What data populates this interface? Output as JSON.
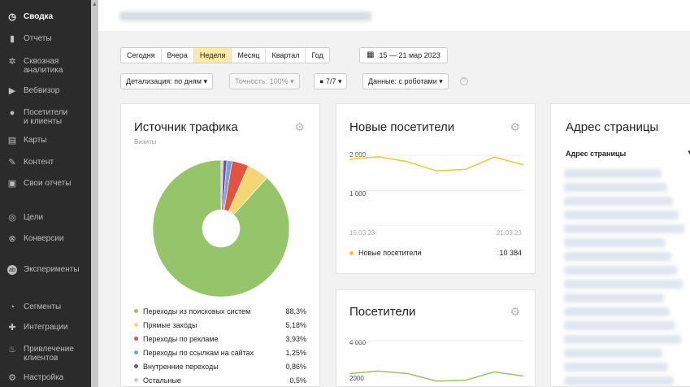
{
  "sidebar": {
    "items": [
      {
        "label": "Сводка",
        "icon": "dashboard-icon",
        "glyph": "◷",
        "active": true
      },
      {
        "label": "Отчеты",
        "icon": "bar-chart-icon",
        "glyph": "▮"
      },
      {
        "label": "Сквозная\nаналитика",
        "icon": "flower-icon",
        "glyph": "✲"
      },
      {
        "label": "Вебвизор",
        "icon": "play-icon",
        "glyph": "▶"
      },
      {
        "label": "Посетители\nи клиенты",
        "icon": "user-icon",
        "glyph": "●"
      },
      {
        "label": "Карты",
        "icon": "map-icon",
        "glyph": "▤"
      },
      {
        "label": "Контент",
        "icon": "pen-icon",
        "glyph": "✎"
      },
      {
        "label": "Свои отчеты",
        "icon": "window-icon",
        "glyph": "▣"
      },
      {
        "label": "Цели",
        "icon": "target-icon",
        "glyph": "◎"
      },
      {
        "label": "Конверсии",
        "icon": "conversion-icon",
        "glyph": "⊗"
      },
      {
        "label": "Эксперименты",
        "icon": "ab-icon",
        "glyph": "ab"
      },
      {
        "label": "Сегменты",
        "icon": "pie-icon",
        "glyph": "◔"
      },
      {
        "label": "Интеграции",
        "icon": "puzzle-icon",
        "glyph": "✚"
      },
      {
        "label": "Привлечение\nклиентов",
        "icon": "fire-icon",
        "glyph": "♨"
      },
      {
        "label": "Настройка",
        "icon": "settings-icon",
        "glyph": "⚙"
      }
    ]
  },
  "period": {
    "options": [
      "Сегодня",
      "Вчера",
      "Неделя",
      "Месяц",
      "Квартал",
      "Год"
    ],
    "selected": "Неделя"
  },
  "daterange": {
    "label": "15 — 21 мар 2023",
    "icon": "calendar-icon"
  },
  "controls": {
    "detail": "Детализация: по дням ▾",
    "accuracy": "Точность: 100% ▾",
    "segments": "● 7/7 ▾",
    "robots": "Данные: с роботами ▾"
  },
  "traffic": {
    "title": "Источник трафика",
    "subtitle": "Визиты",
    "legend": [
      {
        "label": "Переходы из поисковых систем",
        "value": "88,3%",
        "color": "#96c46b"
      },
      {
        "label": "Прямые заходы",
        "value": "5,18%",
        "color": "#f4d774"
      },
      {
        "label": "Переходы по рекламе",
        "value": "3,93%",
        "color": "#e2543f"
      },
      {
        "label": "Переходы по ссылкам на сайтах",
        "value": "1,25%",
        "color": "#6fa7d8"
      },
      {
        "label": "Внутренние переходы",
        "value": "0,86%",
        "color": "#7d4ba5"
      },
      {
        "label": "Остальные",
        "value": "0,5%",
        "color": "#cccccc"
      }
    ]
  },
  "new_visitors": {
    "title": "Новые посетители",
    "y_ticks": [
      "2 000",
      "1 000"
    ],
    "date_start": "15.03.23",
    "date_end": "21.03.23",
    "series_label": "Новые посетители",
    "series_total": "10 384",
    "series_color": "#e6c938"
  },
  "visitors": {
    "title": "Посетители",
    "y_ticks": [
      "4 000",
      "2000"
    ],
    "series_color": "#96c46b"
  },
  "page_address": {
    "title": "Адрес страницы",
    "column_header": "Адрес страницы",
    "sort_icon": "▾"
  },
  "chart_data": [
    {
      "type": "pie",
      "title": "Источник трафика",
      "subtitle": "Визиты",
      "categories": [
        "Переходы из поисковых систем",
        "Прямые заходы",
        "Переходы по рекламе",
        "Переходы по ссылкам на сайтах",
        "Внутренние переходы",
        "Остальные"
      ],
      "values": [
        88.3,
        5.18,
        3.93,
        1.25,
        0.86,
        0.5
      ]
    },
    {
      "type": "line",
      "title": "Новые посетители",
      "x": [
        "15.03.23",
        "16.03.23",
        "17.03.23",
        "18.03.23",
        "19.03.23",
        "20.03.23",
        "21.03.23"
      ],
      "series": [
        {
          "name": "Новые посетители",
          "values": [
            1890,
            1960,
            1820,
            1560,
            1600,
            1950,
            1730
          ]
        }
      ],
      "ylim": [
        0,
        2300
      ]
    },
    {
      "type": "line",
      "title": "Посетители",
      "x": [
        "15.03.23",
        "16.03.23",
        "17.03.23",
        "18.03.23",
        "19.03.23",
        "20.03.23",
        "21.03.23"
      ],
      "series": [
        {
          "values": [
            2050,
            2200,
            2050,
            1600,
            1650,
            2150,
            1900
          ]
        }
      ]
    }
  ]
}
